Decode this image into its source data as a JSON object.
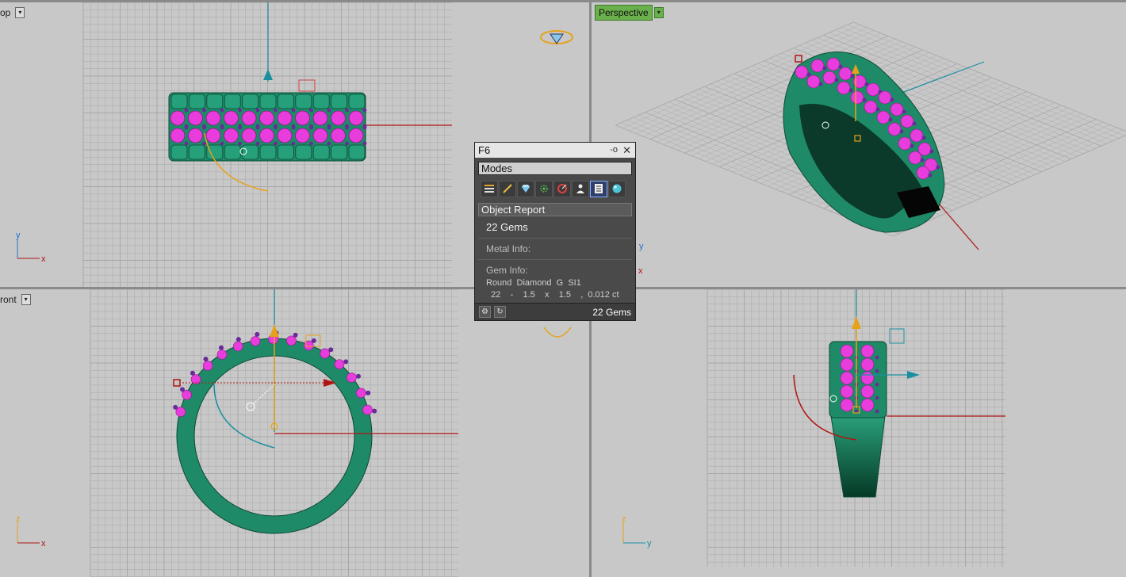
{
  "viewports": {
    "top": {
      "label": "op"
    },
    "perspective": {
      "label": "Perspective"
    },
    "front": {
      "label": "ront"
    },
    "right": {
      "label": ""
    }
  },
  "axis_labels": {
    "x": "x",
    "y": "y",
    "z": "z"
  },
  "panel": {
    "title": "F6",
    "pin_icon": "pin-icon",
    "close_icon": "close-icon",
    "modes_label": "Modes",
    "mode_icons": [
      "list-icon",
      "pencil-icon",
      "diamond-icon",
      "prongs-icon",
      "target-icon",
      "person-icon",
      "report-icon",
      "sphere-icon"
    ],
    "selected_mode_index": 6,
    "object_report_label": "Object Report",
    "gem_count": "22 Gems",
    "metal_info_label": "Metal Info:",
    "gem_info_label": "Gem Info:",
    "gem_desc": "Round  Diamond  G  SI1",
    "gem_line": "  22    -    1.5    x    1.5    ,  0.012 ct",
    "footer_count": "22 Gems"
  },
  "colors": {
    "metal": "#1f8a68",
    "gem": "#e83cdc",
    "prong": "#6a2a9a",
    "axis_x": "#b01414",
    "axis_y": "#1a8fa0",
    "axis_z": "#e6a21a",
    "grid": "#a8a8a8",
    "active_view": "#6ab04c"
  }
}
